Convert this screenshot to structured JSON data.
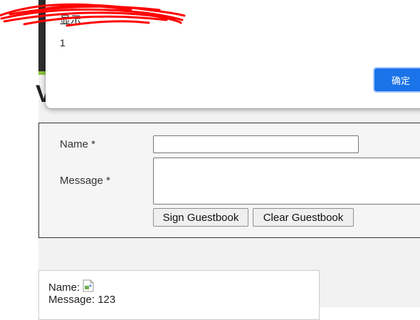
{
  "page": {
    "heading_fragment": "V         y"
  },
  "form": {
    "name_label": "Name *",
    "message_label": "Message *",
    "name_value": "",
    "message_value": "",
    "sign_button": "Sign Guestbook",
    "clear_button": "Clear Guestbook"
  },
  "entries": [
    {
      "name_label": "Name:",
      "message_label": "Message:",
      "message_value": "123"
    }
  ],
  "alert": {
    "title_suffix": "显示",
    "message": "1",
    "ok_button": "确定"
  },
  "colors": {
    "accent": "#1a73e8",
    "redaction": "#ff0000",
    "sidebar_dark": "#2e2e2e",
    "sidebar_green": "#8cc63f"
  }
}
